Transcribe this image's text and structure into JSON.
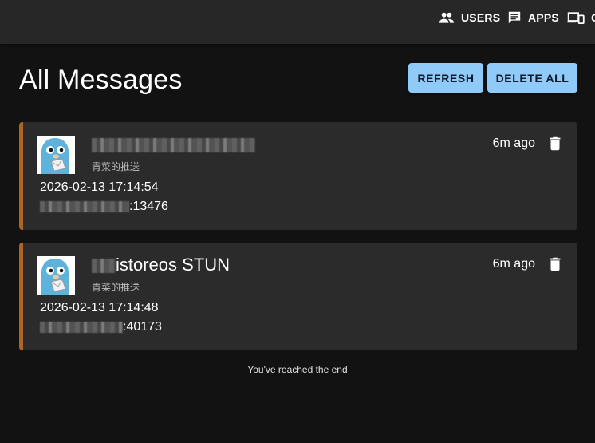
{
  "nav": {
    "users_label": "USERS",
    "apps_label": "APPS",
    "clients_label": "C"
  },
  "page": {
    "title": "All Messages",
    "refresh_label": "REFRESH",
    "delete_all_label": "DELETE ALL"
  },
  "messages": [
    {
      "title_suffix": "",
      "subtitle": "青菜的推送",
      "datetime": "2026-02-13 17:14:54",
      "body_suffix": ":13476",
      "ago": "6m ago"
    },
    {
      "title_suffix": "istoreos STUN",
      "subtitle": "青菜的推送",
      "datetime": "2026-02-13 17:14:48",
      "body_suffix": ":40173",
      "ago": "6m ago"
    }
  ],
  "footer": {
    "end_text": "You've reached the end"
  },
  "colors": {
    "accent": "#90caf9",
    "card_border": "#b0651e",
    "background": "#121212",
    "card": "#2b2b2b",
    "topbar": "#272727"
  },
  "icons": {
    "users": "users-icon",
    "apps": "message-icon",
    "clients": "devices-icon",
    "delete": "trash-icon",
    "avatar": "gopher-avatar"
  }
}
